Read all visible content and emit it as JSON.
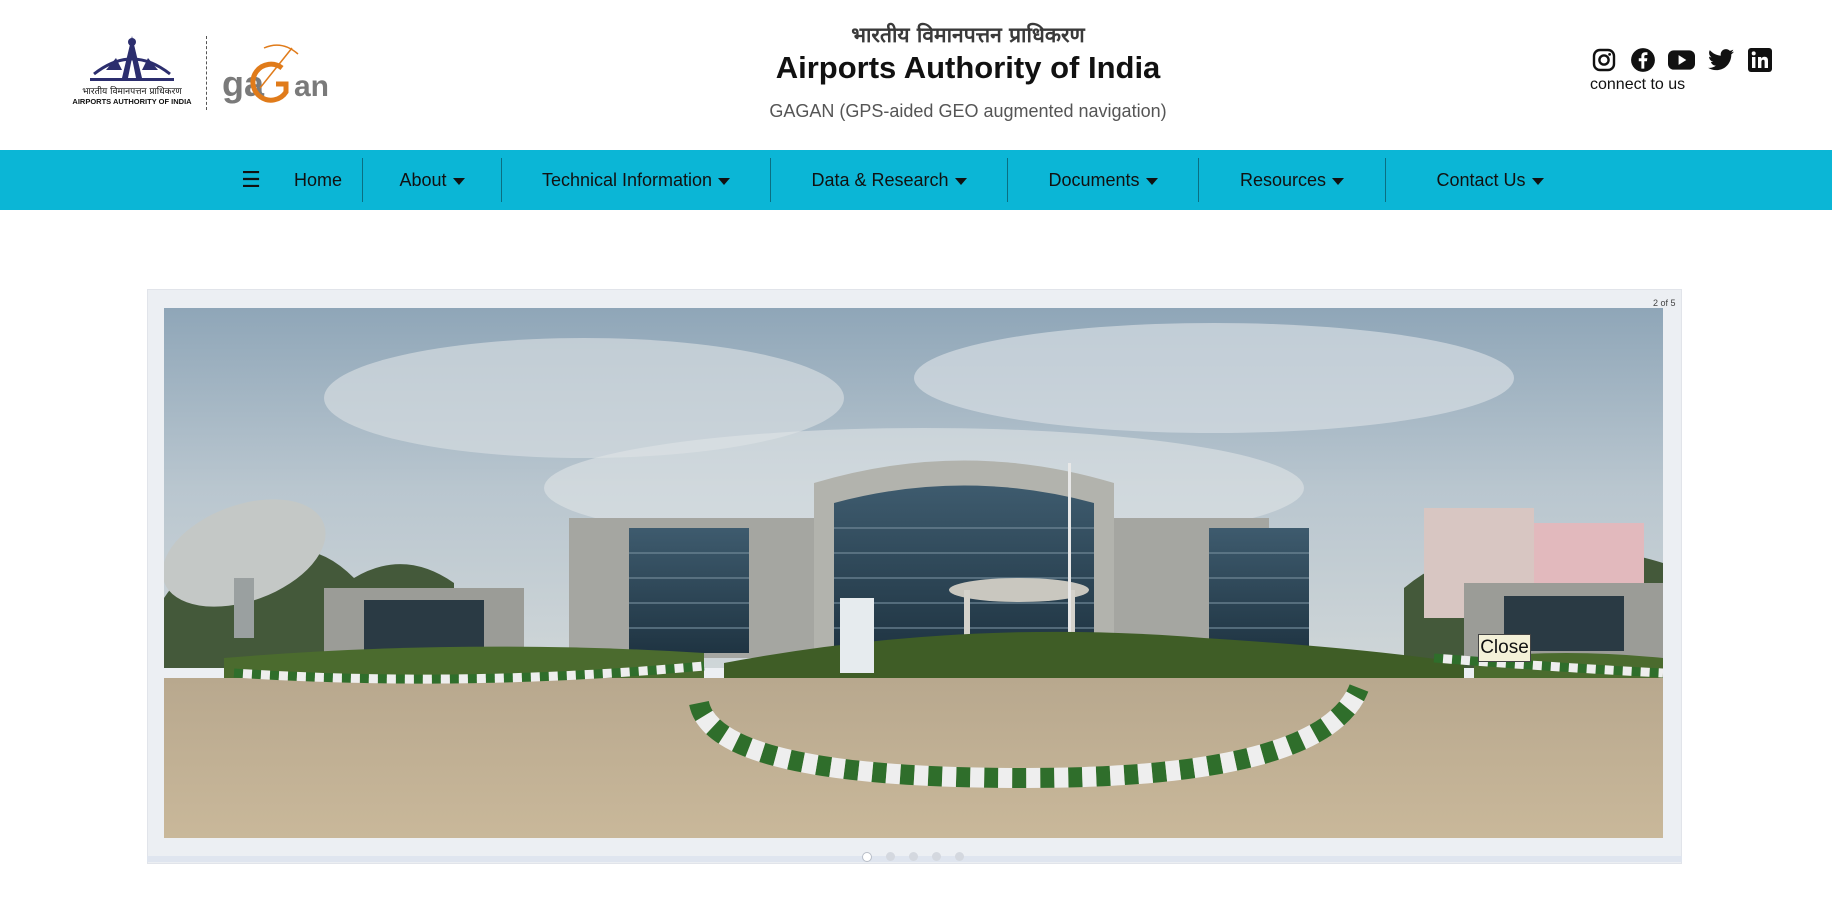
{
  "header": {
    "logo_aai": {
      "hindi_text": "भारतीय विमानपत्तन प्राधिकरण",
      "english_text": "AIRPORTS AUTHORITY OF INDIA",
      "icon": "aai-logo-icon"
    },
    "logo_gagan": {
      "text": "gaGan",
      "icon": "gagan-logo-icon",
      "accent_color": "#e07b1a",
      "text_color": "#7a7a7a"
    },
    "title_hindi": "भारतीय विमानपत्तन प्राधिकरण",
    "title_english": "Airports Authority of India",
    "subtitle": "GAGAN (GPS-aided GEO augmented navigation)",
    "social": {
      "icons": [
        "instagram-icon",
        "facebook-icon",
        "youtube-icon",
        "twitter-icon",
        "linkedin-icon"
      ],
      "label": "connect to us"
    }
  },
  "nav": {
    "background": "#0bb6d6",
    "toggle_icon": "hamburger-menu-icon",
    "items": [
      {
        "label": "Home",
        "has_dropdown": false
      },
      {
        "label": "About",
        "has_dropdown": true
      },
      {
        "label": "Technical Information",
        "has_dropdown": true
      },
      {
        "label": "Data & Research",
        "has_dropdown": true
      },
      {
        "label": "Documents",
        "has_dropdown": true
      },
      {
        "label": "Resources",
        "has_dropdown": true
      },
      {
        "label": "Contact Us",
        "has_dropdown": true
      }
    ]
  },
  "slider": {
    "counter": "2 of 5",
    "close_label": "Close",
    "slide_count": 5,
    "active_index": 0,
    "image_description_icon": "gagan-building-photo"
  }
}
